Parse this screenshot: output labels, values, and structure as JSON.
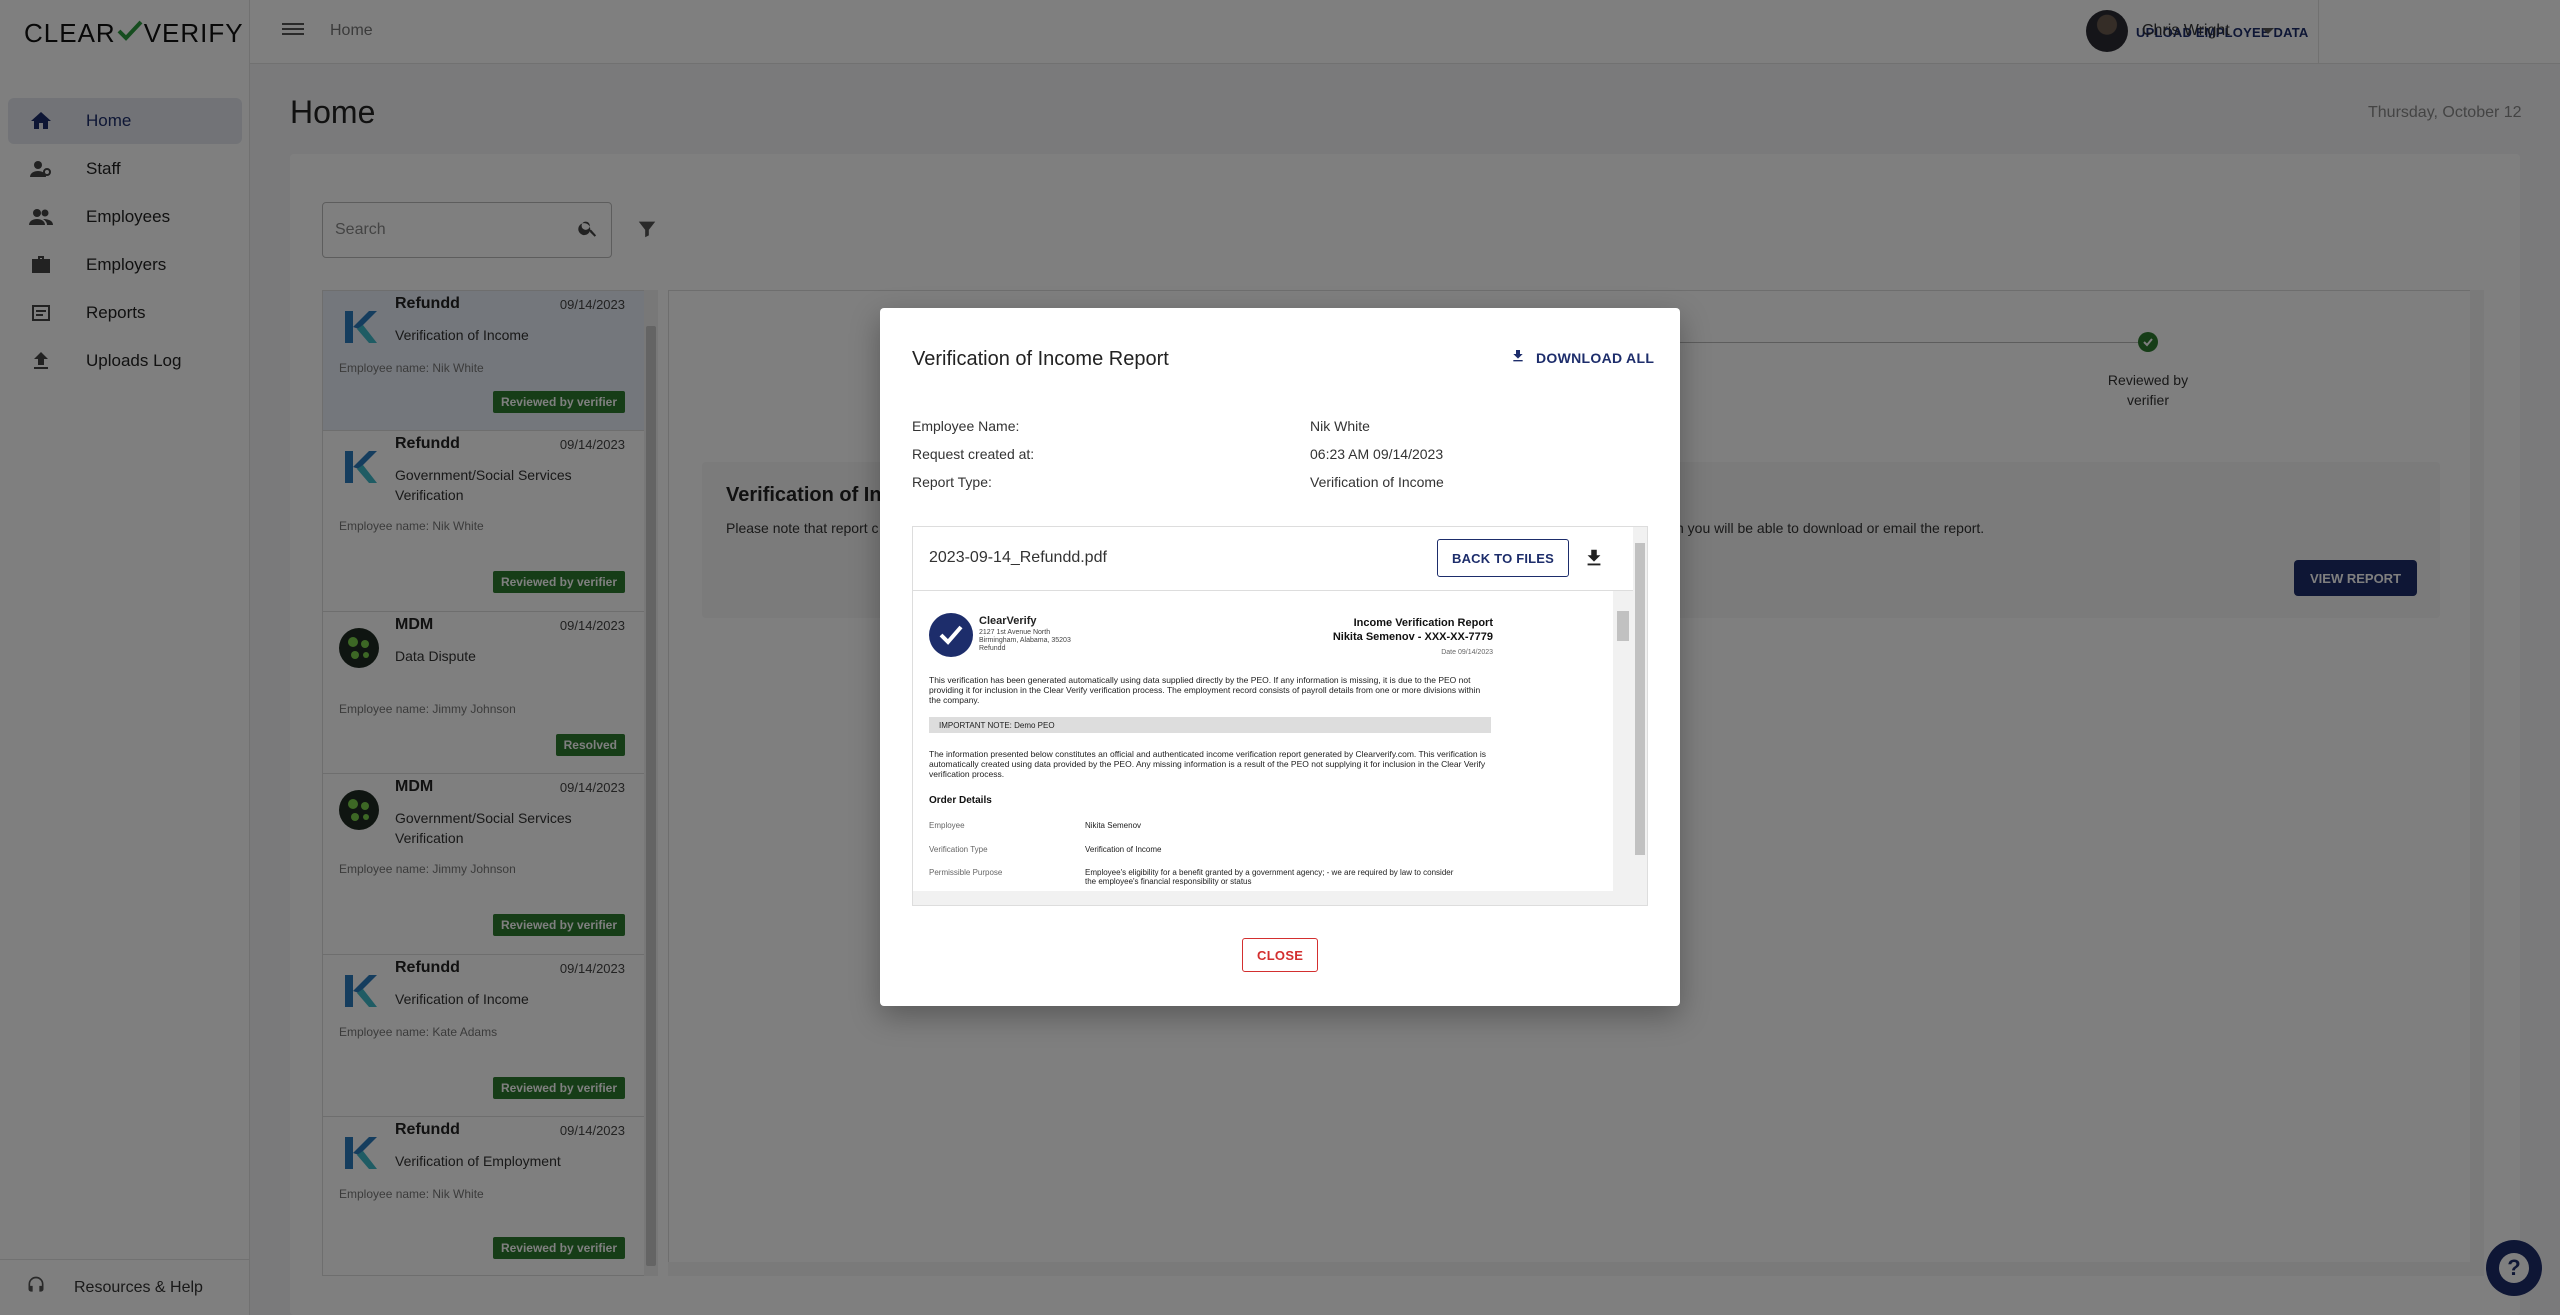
{
  "app": {
    "logo_left": "CLEAR",
    "logo_right": "VERIFY"
  },
  "sidebar": {
    "items": [
      {
        "label": "Home",
        "icon": "home-icon",
        "active": true
      },
      {
        "label": "Staff",
        "icon": "staff-icon"
      },
      {
        "label": "Employees",
        "icon": "employees-icon"
      },
      {
        "label": "Employers",
        "icon": "briefcase-icon"
      },
      {
        "label": "Reports",
        "icon": "reports-icon"
      },
      {
        "label": "Uploads Log",
        "icon": "upload-icon"
      }
    ],
    "footer_label": "Resources & Help"
  },
  "topbar": {
    "breadcrumb": "Home",
    "upload_label": "UPLOAD EMPLOYEE DATA",
    "user_name": "Chris Wright"
  },
  "page": {
    "title": "Home",
    "date": "Thursday, October 12",
    "search_placeholder": "Search"
  },
  "requests": [
    {
      "company": "Refundd",
      "date": "09/14/2023",
      "type": "Verification of Income",
      "employee": "Employee name: Nik White",
      "status": "Reviewed by verifier",
      "logo": "refundd"
    },
    {
      "company": "Refundd",
      "date": "09/14/2023",
      "type": "Government/Social Services Verification",
      "employee": "Employee name: Nik White",
      "status": "Reviewed by verifier",
      "logo": "refundd"
    },
    {
      "company": "MDM",
      "date": "09/14/2023",
      "type": "Data Dispute",
      "employee": "Employee name: Jimmy Johnson",
      "status": "Resolved",
      "logo": "mdm"
    },
    {
      "company": "MDM",
      "date": "09/14/2023",
      "type": "Government/Social Services Verification",
      "employee": "Employee name: Jimmy Johnson",
      "status": "Reviewed by verifier",
      "logo": "mdm"
    },
    {
      "company": "Refundd",
      "date": "09/14/2023",
      "type": "Verification of Income",
      "employee": "Employee name: Kate Adams",
      "status": "Reviewed by verifier",
      "logo": "refundd"
    },
    {
      "company": "Refundd",
      "date": "09/14/2023",
      "type": "Verification of Employment",
      "employee": "Employee name: Nik White",
      "status": "Reviewed by verifier",
      "logo": "refundd"
    }
  ],
  "detail": {
    "step_label": "Reviewed by verifier",
    "section_title": "Verification of Inc",
    "note_left": "Please note that report c",
    "note_right": "n you will be able to download or email the report.",
    "view_report_label": "VIEW REPORT"
  },
  "modal": {
    "title": "Verification of Income Report",
    "download_all_label": "DOWNLOAD ALL",
    "fields": [
      {
        "label": "Employee Name:",
        "value": "Nik White"
      },
      {
        "label": "Request created at:",
        "value": "06:23 AM 09/14/2023"
      },
      {
        "label": "Report Type:",
        "value": "Verification of Income"
      }
    ],
    "file_name": "2023-09-14_Refundd.pdf",
    "back_label": "BACK TO FILES",
    "close_label": "CLOSE"
  },
  "pdf": {
    "brand": "ClearVerify",
    "address_1": "2127 1st Avenue North",
    "address_2": "Birmingham, Alabama, 35203",
    "address_3": "Refundd",
    "title": "Income Verification Report",
    "subject": "Nikita Semenov - XXX-XX-7779",
    "date": "Date 09/14/2023",
    "para_1": "This verification has been generated automatically using data supplied directly by the PEO. If any information is missing, it is due to the PEO not providing it for inclusion in the Clear Verify verification process. The employment record consists of payroll details from one or more divisions within the company.",
    "note": "IMPORTANT NOTE: Demo PEO",
    "para_2": "The information presented below constitutes an official and authenticated income verification report generated by Clearverify.com. This verification is automatically created using data provided by the PEO. Any missing information is a result of the PEO not supplying it for inclusion in the Clear Verify verification process.",
    "order_heading": "Order Details",
    "order_rows": [
      {
        "key": "Employee",
        "value": "Nikita Semenov"
      },
      {
        "key": "Verification Type",
        "value": "Verification of Income"
      },
      {
        "key": "Permissible Purpose",
        "value": "Employee's eligibility for a benefit granted by a government agency; - we are required by law to consider the employee's financial responsibility or status"
      }
    ]
  },
  "colors": {
    "brand": "#1d2d6b",
    "badge": "#2c7a2e",
    "close": "#d32f2f"
  }
}
